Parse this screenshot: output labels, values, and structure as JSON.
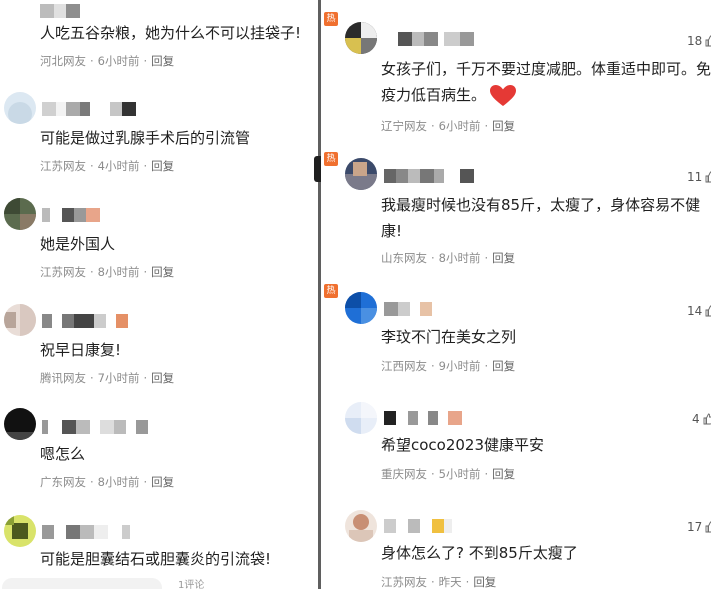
{
  "left": {
    "comments": [
      {
        "text": "人吃五谷杂粮，她为什么不可以挂袋子!",
        "region": "河北网友",
        "time": "6小时前",
        "reply": "回复"
      },
      {
        "text": "可能是做过乳腺手术后的引流管",
        "region": "江苏网友",
        "time": "4小时前",
        "reply": "回复"
      },
      {
        "text": "她是外国人",
        "region": "江苏网友",
        "time": "8小时前",
        "reply": "回复"
      },
      {
        "text": "祝早日康复!",
        "region": "腾讯网友",
        "time": "7小时前",
        "reply": "回复"
      },
      {
        "text": "嗯怎么",
        "region": "广东网友",
        "time": "8小时前",
        "reply": "回复"
      },
      {
        "text": "可能是胆囊结石或胆囊炎的引流袋!",
        "region": "",
        "time": "",
        "reply": ""
      }
    ],
    "bottom_text": "1评论"
  },
  "right": {
    "comments": [
      {
        "hot": "热",
        "likes": "18",
        "text": "女孩子们，千万不要过度减肥。体重适中即可。免疫力低百病生。",
        "region": "辽宁网友",
        "time": "6小时前",
        "reply": "回复"
      },
      {
        "hot": "热",
        "likes": "11",
        "text": "我最瘦时候也没有85斤，太瘦了，身体容易不健康!",
        "region": "山东网友",
        "time": "8小时前",
        "reply": "回复"
      },
      {
        "hot": "热",
        "likes": "14",
        "text": "李玟不门在美女之列",
        "region": "江西网友",
        "time": "9小时前",
        "reply": "回复"
      },
      {
        "hot": "",
        "likes": "4",
        "text": "希望coco2023健康平安",
        "region": "重庆网友",
        "time": "5小时前",
        "reply": "回复"
      },
      {
        "hot": "",
        "likes": "17",
        "text": "身体怎么了? 不到85斤太瘦了",
        "region": "江苏网友",
        "time": "昨天",
        "reply": "回复"
      }
    ]
  },
  "colors": {
    "hot_badge": "#f0702f",
    "meta_text": "#8c8c8c",
    "heart": "#e53935",
    "divider": "#5f5f5f"
  },
  "icons": {
    "like": "thumbs-up-icon",
    "heart": "heart-icon"
  }
}
